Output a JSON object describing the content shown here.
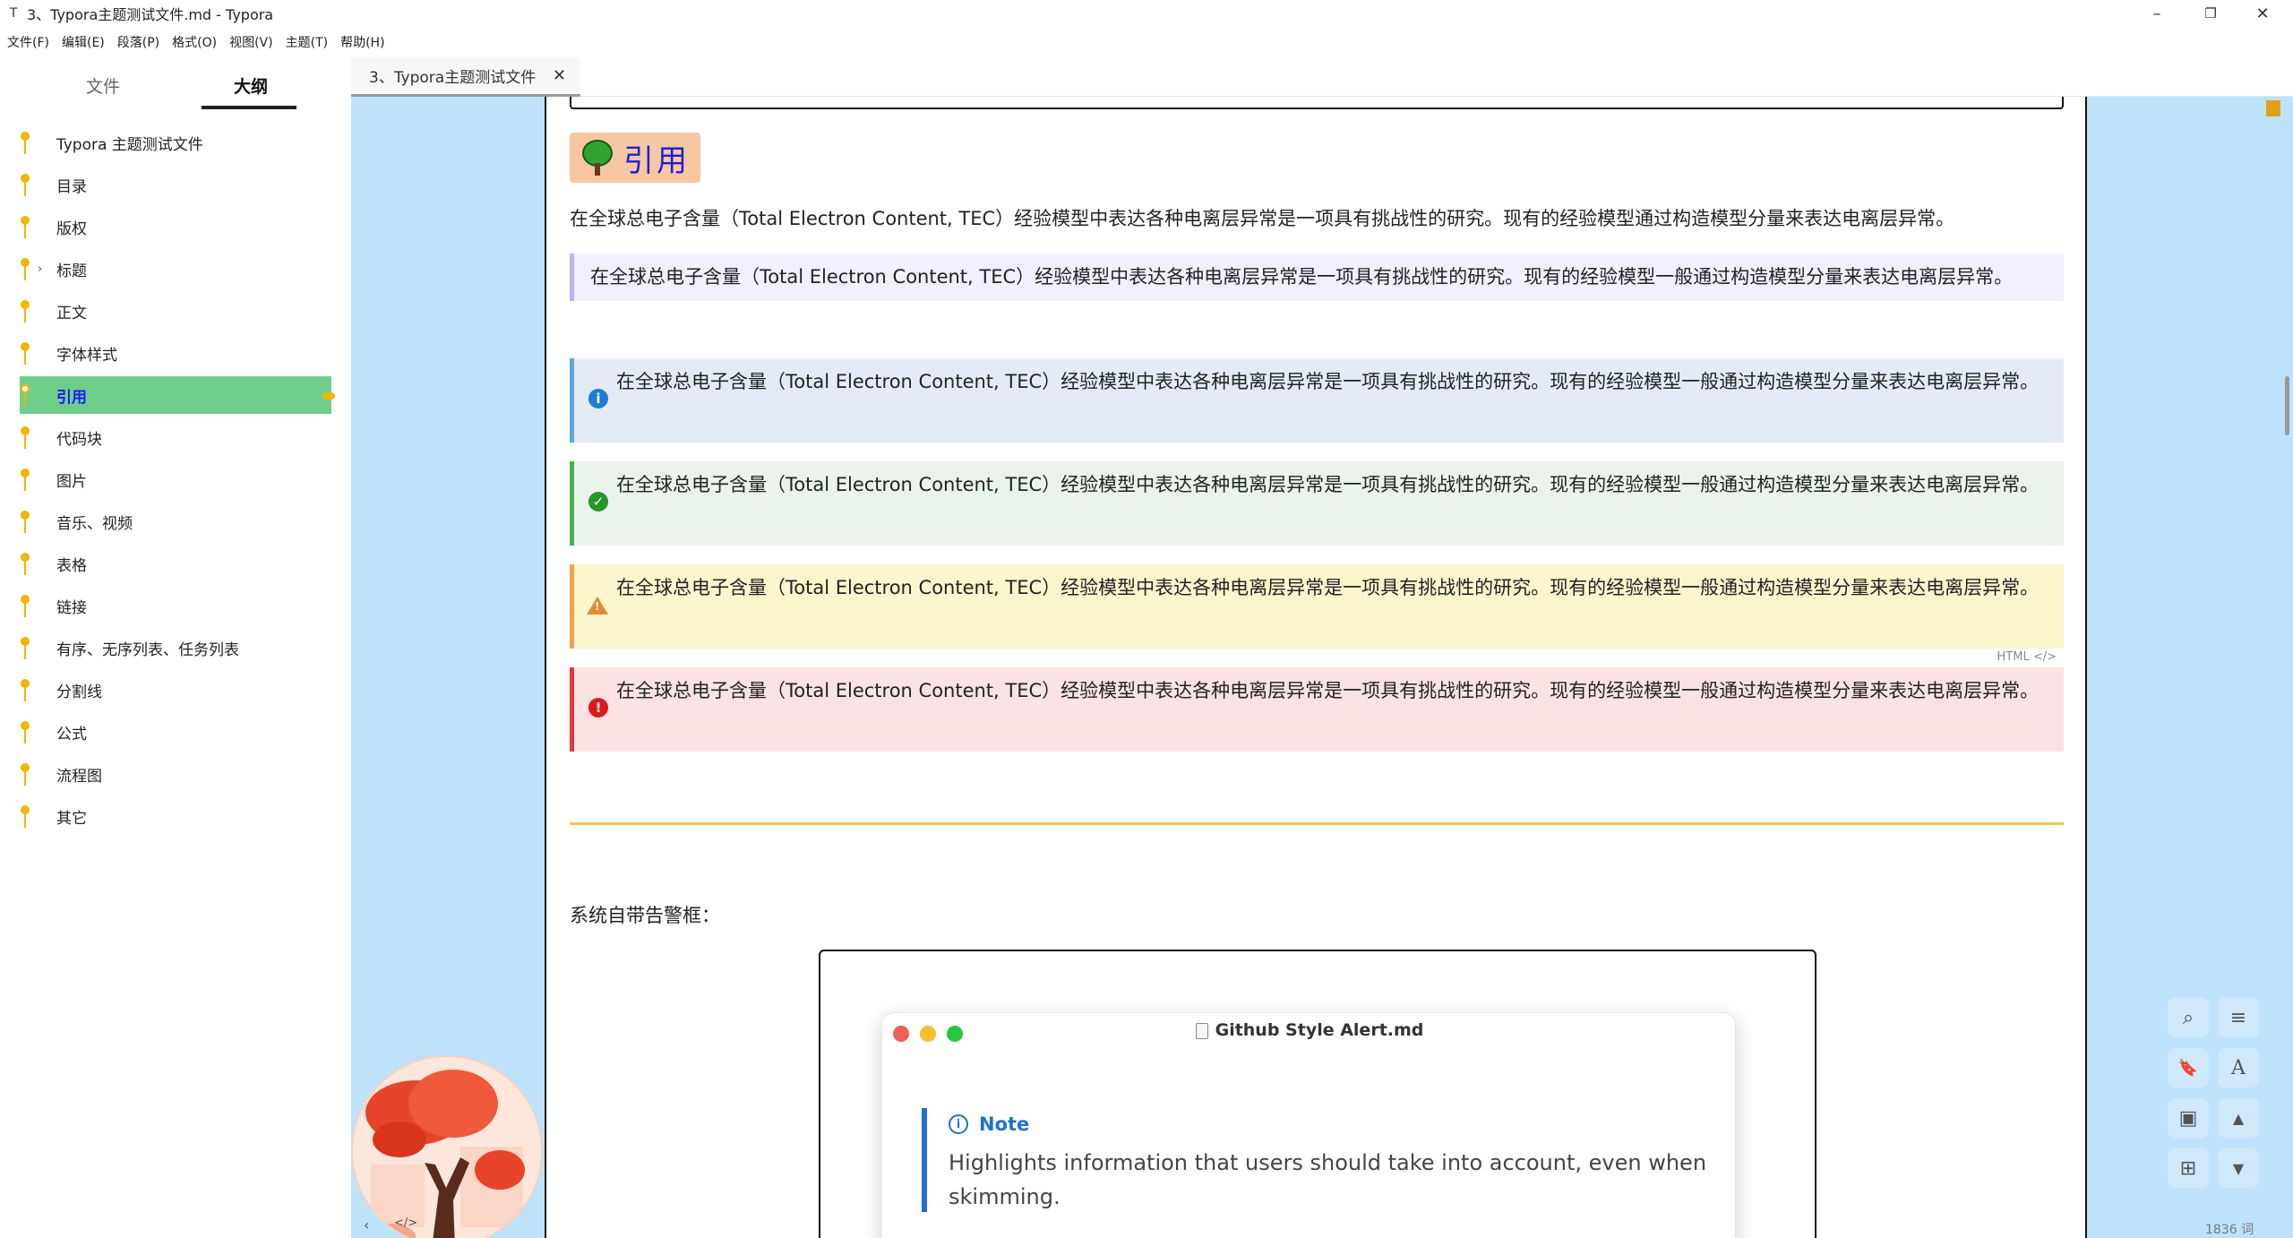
{
  "window": {
    "app_icon": "T",
    "title": "3、Typora主题测试文件.md - Typora",
    "minimize": "–",
    "maximize": "❐",
    "close": "✕"
  },
  "menu": [
    "文件(F)",
    "编辑(E)",
    "段落(P)",
    "格式(O)",
    "视图(V)",
    "主题(T)",
    "帮助(H)"
  ],
  "sidebar": {
    "tabs": {
      "files": "文件",
      "outline": "大纲"
    },
    "items": [
      {
        "label": "Typora 主题测试文件",
        "expandable": false
      },
      {
        "label": "目录",
        "expandable": false
      },
      {
        "label": "版权",
        "expandable": false
      },
      {
        "label": "标题",
        "expandable": true
      },
      {
        "label": "正文",
        "expandable": false
      },
      {
        "label": "字体样式",
        "expandable": false
      },
      {
        "label": "引用",
        "expandable": false,
        "active": true
      },
      {
        "label": "代码块",
        "expandable": false
      },
      {
        "label": "图片",
        "expandable": false
      },
      {
        "label": "音乐、视频",
        "expandable": false
      },
      {
        "label": "表格",
        "expandable": false
      },
      {
        "label": "链接",
        "expandable": false
      },
      {
        "label": "有序、无序列表、任务列表",
        "expandable": false
      },
      {
        "label": "分割线",
        "expandable": false
      },
      {
        "label": "公式",
        "expandable": false
      },
      {
        "label": "流程图",
        "expandable": false
      },
      {
        "label": "其它",
        "expandable": false
      }
    ],
    "expand_glyph": "›",
    "nav_prev": "‹",
    "nav_source": "</>"
  },
  "tabbar": {
    "doc_tab": "3、Typora主题测试文件",
    "close_glyph": "✕"
  },
  "document": {
    "heading": "引用",
    "paragraph": "在全球总电子含量（Total Electron Content, TEC）经验模型中表达各种电离层异常是一项具有挑战性的研究。现有的经验模型通过构造模型分量来表达电离层异常。",
    "blockquote": "在全球总电子含量（Total Electron Content, TEC）经验模型中表达各种电离层异常是一项具有挑战性的研究。现有的经验模型一般通过构造模型分量来表达电离层异常。",
    "callouts": [
      {
        "kind": "note",
        "icon": "info-icon",
        "glyph": "i",
        "text": "在全球总电子含量（Total Electron Content, TEC）经验模型中表达各种电离层异常是一项具有挑战性的研究。现有的经验模型一般通过构造模型分量来表达电离层异常。"
      },
      {
        "kind": "tip",
        "icon": "check-icon",
        "glyph": "✓",
        "text": "在全球总电子含量（Total Electron Content, TEC）经验模型中表达各种电离层异常是一项具有挑战性的研究。现有的经验模型一般通过构造模型分量来表达电离层异常。"
      },
      {
        "kind": "warning",
        "icon": "warning-icon",
        "glyph": "!",
        "text": "在全球总电子含量（Total Electron Content, TEC）经验模型中表达各种电离层异常是一项具有挑战性的研究。现有的经验模型一般通过构造模型分量来表达电离层异常。"
      },
      {
        "kind": "error",
        "icon": "error-icon",
        "glyph": "!",
        "text": "在全球总电子含量（Total Electron Content, TEC）经验模型中表达各种电离层异常是一项具有挑战性的研究。现有的经验模型一般通过构造模型分量来表达电离层异常。"
      }
    ],
    "html_badge": "HTML </>",
    "system_alert_label": "系统自带告警框：",
    "figure": {
      "window_title": "Github Style Alert.md",
      "note_title": "Note",
      "note_body": "Highlights information that users should take into account, even when skimming."
    }
  },
  "tools": {
    "search": "⌕",
    "outline": "≡",
    "bookmark": "🔖",
    "font": "A",
    "image": "▣",
    "up": "▲",
    "tree": "⊞",
    "down": "▼"
  },
  "status": {
    "word_count": "1836 词"
  },
  "colors": {
    "workspace_bg": "#bfe2fb",
    "outline_active": "#6fcf8a",
    "pin": "#f4b400",
    "heading_bg": "#f7c6a2",
    "heading_text": "#1d22d6",
    "note": "#1e7bd8",
    "tip": "#269726",
    "warning": "#e8873a",
    "error": "#e0181e",
    "divider": "#f4c542"
  }
}
